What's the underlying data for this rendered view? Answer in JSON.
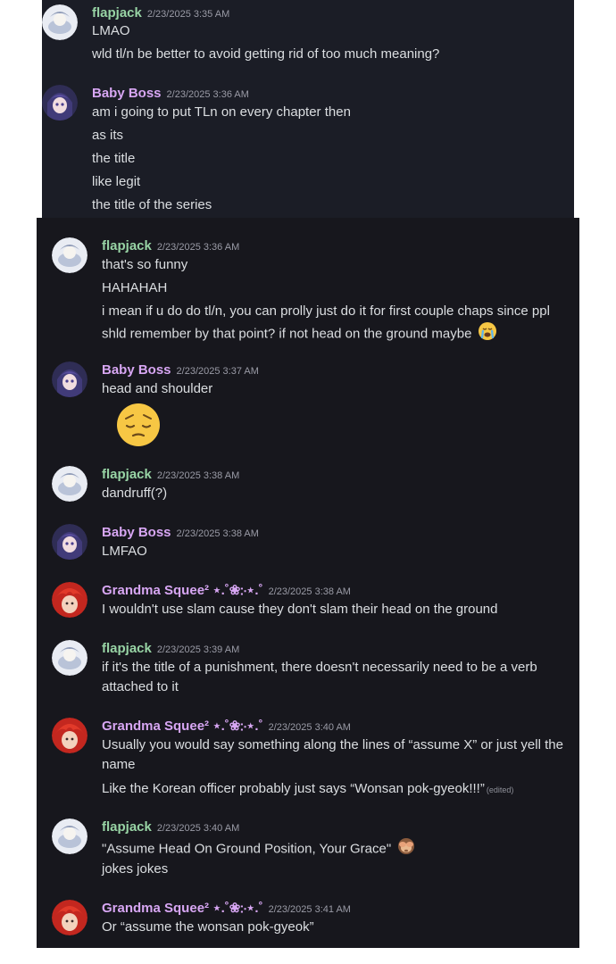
{
  "colors": {
    "flapjack": "#98d4a5",
    "baby_boss": "#d7a6f3",
    "grandma": "#d7a6f3",
    "text": "#dbdee1",
    "timestamp": "#9a9ba6"
  },
  "messages": [
    {
      "author": "flapjack",
      "time": "2/23/2025 3:35 AM",
      "lines": [
        "LMAO",
        "wld tl/n be better to avoid getting rid of too much meaning?"
      ]
    },
    {
      "author": "Baby Boss",
      "time": "2/23/2025 3:36 AM",
      "lines": [
        "am i going to put TLn on every chapter then",
        "as its",
        "the title",
        "like legit",
        "the title of the series"
      ]
    },
    {
      "author": "flapjack",
      "time": "2/23/2025 3:36 AM",
      "lines": [
        "that's so funny",
        "HAHAHAH",
        "i mean if u do do tl/n, you can prolly just do it for first couple chaps since ppl",
        "shld remember by that point? if not head on the ground maybe"
      ],
      "emoji": "loudly-crying-face"
    },
    {
      "author": "Baby Boss",
      "time": "2/23/2025 3:37 AM",
      "lines": [
        "head and shoulder"
      ],
      "big_emoji": "pensive-face"
    },
    {
      "author": "flapjack",
      "time": "2/23/2025 3:38 AM",
      "lines": [
        "dandruff(?)"
      ]
    },
    {
      "author": "Baby Boss",
      "time": "2/23/2025 3:38 AM",
      "lines": [
        "LMFAO"
      ]
    },
    {
      "author": "Grandma Squee² ⋆.˚❀჻⋆.˚",
      "time": "2/23/2025 3:38 AM",
      "lines": [
        "I wouldn't use slam cause they don't slam their head on the ground"
      ]
    },
    {
      "author": "flapjack",
      "time": "2/23/2025 3:39 AM",
      "lines": [
        "if it's the title of a punishment, there doesn't necessarily need to be a verb",
        "attached to it"
      ]
    },
    {
      "author": "Grandma Squee² ⋆.˚❀჻⋆.˚",
      "time": "2/23/2025 3:40 AM",
      "lines": [
        "Usually you would say something along the lines of “assume X” or just yell the",
        "name",
        "Like the Korean officer probably just says “Wonsan pok-gyeok!!!”"
      ],
      "edited": "(edited)"
    },
    {
      "author": "flapjack",
      "time": "2/23/2025 3:40 AM",
      "lines": [
        "\"Assume Head On Ground Position, Your Grace\"",
        "jokes jokes"
      ],
      "emoji": "see-no-evil-monkey"
    },
    {
      "author": "Grandma Squee² ⋆.˚❀჻⋆.˚",
      "time": "2/23/2025 3:41 AM",
      "lines": [
        "Or “assume the wonsan pok-gyeok”"
      ]
    }
  ]
}
